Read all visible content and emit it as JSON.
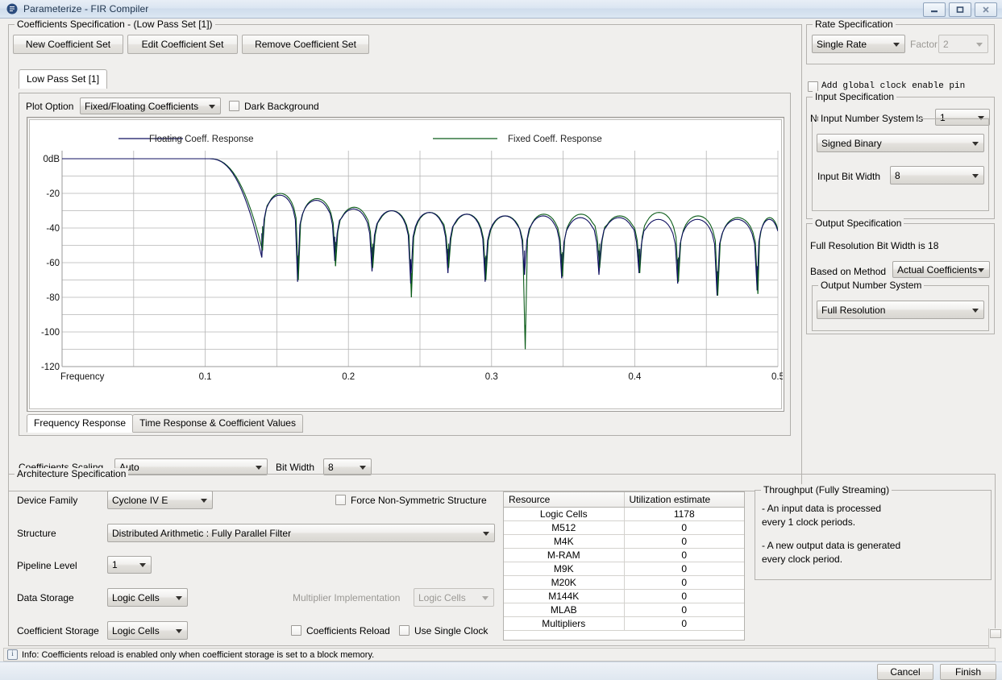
{
  "window": {
    "title": "Parameterize - FIR Compiler",
    "icon": "app-icon",
    "controls": {
      "minimize": "minimize-icon",
      "maximize": "maximize-icon",
      "close": "close-icon"
    }
  },
  "coefficients": {
    "group_title": "Coefficients Specification - (Low Pass Set [1])",
    "buttons": {
      "new": "New Coefficient Set",
      "edit": "Edit Coefficient Set",
      "remove": "Remove Coefficient Set"
    },
    "tab": "Low Pass Set [1]",
    "plot_option_label": "Plot Option",
    "plot_option_value": "Fixed/Floating Coefficients",
    "dark_background_label": "Dark Background",
    "dark_background_checked": false,
    "plot_tabs": [
      {
        "label": "Frequency Response",
        "active": true
      },
      {
        "label": "Time Response & Coefficient Values",
        "active": false
      }
    ],
    "scaling_label": "Coefficients Scaling",
    "scaling_value": "Auto",
    "bitwidth_label": "Bit Width",
    "bitwidth_value": "8"
  },
  "chart_data": {
    "type": "line",
    "title": "",
    "xlabel": "Frequency",
    "ylabel": "",
    "xlim": [
      0.0,
      0.5
    ],
    "ylim": [
      -120,
      0
    ],
    "xticks": [
      "0.1",
      "0.2",
      "0.3",
      "0.4",
      "0.5"
    ],
    "xtick_values": [
      0.1,
      0.2,
      0.3,
      0.4,
      0.5
    ],
    "yticks": [
      "0dB",
      "-20",
      "-40",
      "-60",
      "-80",
      "-100",
      "-120"
    ],
    "ytick_values": [
      0,
      -20,
      -40,
      -60,
      -80,
      -100,
      -120
    ],
    "grid": true,
    "legend_position": "top",
    "series": [
      {
        "name": "Floating Coeff. Response",
        "color": "#101060",
        "passband_edge": 0.112,
        "null_frequencies": [
          0.1395,
          0.1645,
          0.1905,
          0.2165,
          0.2435,
          0.2695,
          0.2955,
          0.323,
          0.349,
          0.375,
          0.403,
          0.43,
          0.4575,
          0.4855
        ],
        "null_depths_db": [
          -57,
          -71,
          -59,
          -65,
          -72,
          -66,
          -71,
          -67,
          -69,
          -67,
          -66,
          -72,
          -79,
          -76
        ],
        "sidelobe_peaks_db": [
          -21,
          -24,
          -29,
          -30,
          -31,
          -32,
          -33,
          -33,
          -34,
          -34,
          -35,
          -35,
          -35,
          -35
        ]
      },
      {
        "name": "Fixed Coeff. Response",
        "color": "#0b5c19",
        "passband_edge": 0.112,
        "null_frequencies": [
          0.14,
          0.165,
          0.191,
          0.217,
          0.244,
          0.27,
          0.296,
          0.3235,
          0.3495,
          0.3755,
          0.4035,
          0.4305,
          0.458,
          0.486
        ],
        "null_depths_db": [
          -53,
          -70,
          -62,
          -63,
          -80,
          -63,
          -70,
          -110,
          -68,
          -63,
          -66,
          -71,
          -79,
          -78
        ],
        "sidelobe_peaks_db": [
          -20,
          -23,
          -28,
          -30,
          -31,
          -32,
          -33,
          -32,
          -32,
          -33,
          -31,
          -33,
          -34,
          -34
        ]
      }
    ]
  },
  "architecture": {
    "group_title": "Architecture Specification",
    "device_family_label": "Device Family",
    "device_family_value": "Cyclone IV E",
    "force_nonsym_label": "Force Non-Symmetric Structure",
    "force_nonsym_checked": false,
    "structure_label": "Structure",
    "structure_value": "Distributed Arithmetic : Fully Parallel Filter",
    "pipeline_label": "Pipeline Level",
    "pipeline_value": "1",
    "data_storage_label": "Data Storage",
    "data_storage_value": "Logic Cells",
    "multiplier_impl_label": "Multiplier Implementation",
    "multiplier_impl_value": "Logic Cells",
    "coeff_storage_label": "Coefficient Storage",
    "coeff_storage_value": "Logic Cells",
    "coeff_reload_label": "Coefficients Reload",
    "coeff_reload_checked": false,
    "single_clock_label": "Use Single Clock",
    "single_clock_checked": false
  },
  "resources": {
    "headers": [
      "Resource",
      "Utilization estimate"
    ],
    "rows": [
      [
        "Logic Cells",
        "1178"
      ],
      [
        "M512",
        "0"
      ],
      [
        "M4K",
        "0"
      ],
      [
        "M-RAM",
        "0"
      ],
      [
        "M9K",
        "0"
      ],
      [
        "M20K",
        "0"
      ],
      [
        "M144K",
        "0"
      ],
      [
        "MLAB",
        "0"
      ],
      [
        "Multipliers",
        "0"
      ]
    ]
  },
  "throughput": {
    "group_title": "Throughput (Fully Streaming)",
    "line1": "- An input data is processed",
    "line2": "every 1 clock periods.",
    "line3": "- A new output data is generated",
    "line4": "every clock period."
  },
  "rate": {
    "group_title": "Rate Specification",
    "rate_value": "Single Rate",
    "factor_label": "Factor",
    "factor_value": "2"
  },
  "global_clock": {
    "label": "Add global clock enable pin",
    "checked": false
  },
  "input_spec": {
    "group_title": "Input Specification",
    "channels_label": "Number of Input Channels",
    "channels_value": "1",
    "number_system_title": "Input Number System",
    "number_system_value": "Signed Binary",
    "bitwidth_label": "Input Bit Width",
    "bitwidth_value": "8"
  },
  "output_spec": {
    "group_title": "Output Specification",
    "full_resolution_text": "Full Resolution Bit Width is 18",
    "method_label": "Based on Method",
    "method_value": "Actual Coefficients",
    "number_system_title": "Output Number System",
    "number_system_value": "Full Resolution"
  },
  "status": {
    "icon": "info-icon",
    "text": "Info: Coefficients reload is enabled only when coefficient storage is set to a block memory."
  },
  "footer": {
    "cancel": "Cancel",
    "finish": "Finish"
  },
  "colors": {
    "floating": "#101060",
    "fixed": "#0b5c19",
    "panel": "#f0efed",
    "titlebar": "#dbe6f2"
  }
}
